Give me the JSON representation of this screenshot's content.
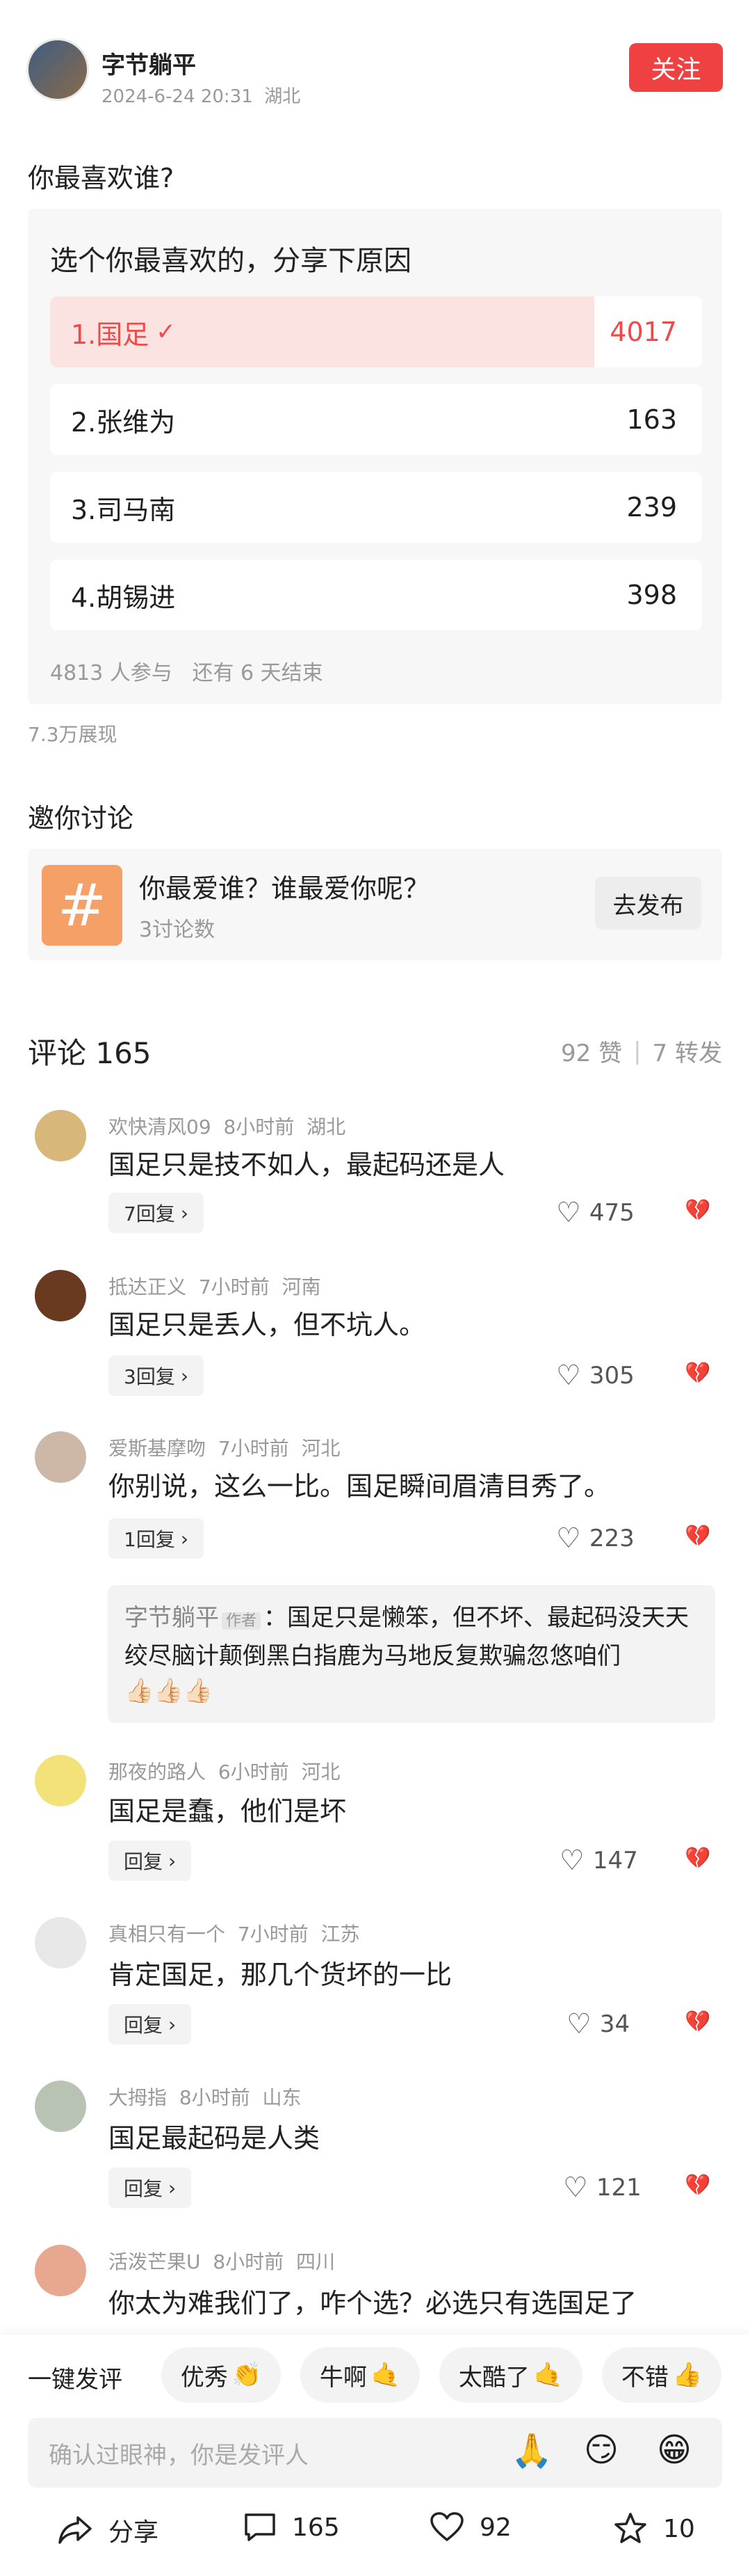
{
  "post": {
    "author": "字节躺平",
    "timestamp": "2024-6-24 20:31",
    "location": "湖北",
    "follow_label": "关注",
    "question": "你最喜欢谁?"
  },
  "poll": {
    "prompt": "选个你最喜欢的，分享下原因",
    "options": [
      {
        "label": "1.国足",
        "count": "4017",
        "fraction": 0.835,
        "selected": true
      },
      {
        "label": "2.张维为",
        "count": "163"
      },
      {
        "label": "3.司马南",
        "count": "239"
      },
      {
        "label": "4.胡锡进",
        "count": "398"
      }
    ],
    "participants": "4813 人参与",
    "remaining": "还有 6 天结束",
    "views": "7.3万展现"
  },
  "invite": {
    "heading": "邀你讨论",
    "topic_title": "你最爱谁？谁最爱你呢？",
    "topic_sub": "3讨论数",
    "post_label": "去发布"
  },
  "comments_header": {
    "title": "评论 165",
    "likes": "92 赞",
    "separator": "|",
    "shares": "7 转发"
  },
  "comments": [
    {
      "user": "欢快清风09",
      "time": "8小时前",
      "loc": "湖北",
      "text": "国足只是技不如人，最起码还是人",
      "reply": "7回复",
      "likes": "475"
    },
    {
      "user": "抵达正义",
      "time": "7小时前",
      "loc": "河南",
      "text": "国足只是丢人，但不坑人。",
      "reply": "3回复",
      "likes": "305"
    },
    {
      "user": "爱斯基摩吻",
      "time": "7小时前",
      "loc": "河北",
      "text": "你别说，这么一比。国足瞬间眉清目秀了。",
      "reply": "1回复",
      "likes": "223"
    },
    {
      "user": "那夜的路人",
      "time": "6小时前",
      "loc": "河北",
      "text": "国足是蠢，他们是坏",
      "reply": "回复",
      "likes": "147"
    },
    {
      "user": "真相只有一个",
      "time": "7小时前",
      "loc": "江苏",
      "text": "肯定国足，那几个货坏的一比",
      "reply": "回复",
      "likes": "34"
    },
    {
      "user": "大拇指",
      "time": "8小时前",
      "loc": "山东",
      "text": "国足最起码是人类",
      "reply": "回复",
      "likes": "121"
    },
    {
      "user": "活泼芒果U",
      "time": "8小时前",
      "loc": "四川",
      "text": "你太为难我们了，咋个选？必选只有选国足了"
    }
  ],
  "author_reply": {
    "name": "字节躺平",
    "tag": "作者",
    "text": "：国足只是懒笨，但不坏、最起码没天天绞尽脑计颠倒黑白指鹿为马地反复欺骗忽悠咱们",
    "emojis": "👍🏻👍🏻👍🏻"
  },
  "quick_reply": {
    "label": "一键发评",
    "chips": [
      {
        "text": "优秀",
        "emoji": "👏"
      },
      {
        "text": "牛啊",
        "emoji": "🤙"
      },
      {
        "text": "太酷了",
        "emoji": "🤙"
      },
      {
        "text": "不错",
        "emoji": "👍"
      }
    ]
  },
  "input": {
    "placeholder": "确认过眼神，你是发评人",
    "emojis": [
      "🙏",
      "😏",
      "😁"
    ]
  },
  "actions": {
    "share": "分享",
    "comments": "165",
    "likes": "92",
    "favorites": "10"
  },
  "colors": {
    "accent": "#f04142",
    "poll_fill": "#fbe3e2",
    "selected_text": "#ee4a49",
    "hash_bg": "#f5a067"
  }
}
